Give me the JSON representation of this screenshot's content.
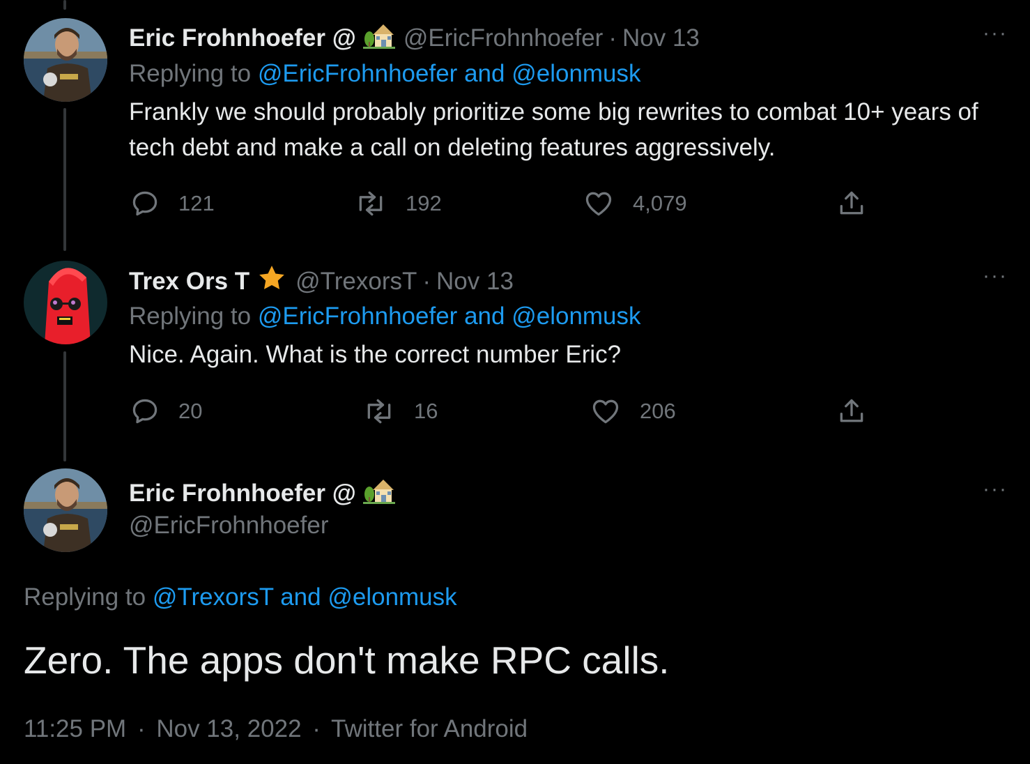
{
  "thread": [
    {
      "name": "Eric Frohnhoefer @",
      "badge_icon": "house-with-garden-emoji",
      "handle": "@EricFrohnhoefer",
      "separator": "·",
      "date": "Nov 13",
      "replying_prefix": "Replying to",
      "replying_user1": "@EricFrohnhoefer",
      "replying_and": "and",
      "replying_user2": "@elonmusk",
      "text": "Frankly we should probably prioritize some big rewrites to combat 10+ years of tech debt and make a call on deleting features aggressively.",
      "replies": "121",
      "retweets": "192",
      "likes": "4,079",
      "more": "···"
    },
    {
      "name": "Trex Ors T",
      "badge_icon": "star-emoji",
      "handle": "@TrexorsT",
      "separator": "·",
      "date": "Nov 13",
      "replying_prefix": "Replying to",
      "replying_user1": "@EricFrohnhoefer",
      "replying_and": "and",
      "replying_user2": "@elonmusk",
      "text": "Nice. Again. What is the correct number Eric?",
      "replies": "20",
      "retweets": "16",
      "likes": "206",
      "more": "···"
    }
  ],
  "main_tweet": {
    "name": "Eric Frohnhoefer @",
    "badge_icon": "house-with-garden-emoji",
    "handle": "@EricFrohnhoefer",
    "replying_prefix": "Replying to",
    "replying_user1": "@TrexorsT",
    "replying_and": "and",
    "replying_user2": "@elonmusk",
    "text": "Zero. The apps don't make RPC calls.",
    "time": "11:25 PM",
    "separator": "·",
    "date": "Nov 13, 2022",
    "source": "Twitter for Android",
    "more": "···"
  },
  "colors": {
    "background": "#000000",
    "text": "#e7e9ea",
    "muted": "#71767b",
    "link": "#1d9bf0",
    "thread_line": "#333639"
  }
}
